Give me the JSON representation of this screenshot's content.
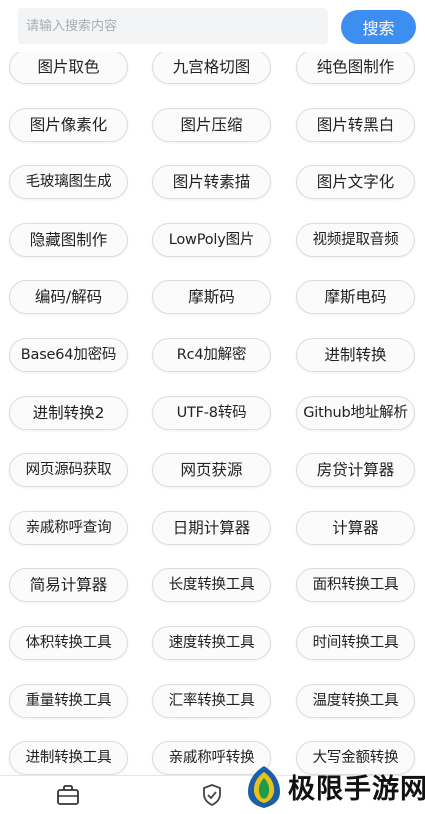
{
  "search": {
    "placeholder": "请输入搜索内容",
    "button_label": "搜索"
  },
  "tools": [
    "图片取色",
    "九宫格切图",
    "纯色图制作",
    "图片像素化",
    "图片压缩",
    "图片转黑白",
    "毛玻璃图生成",
    "图片转素描",
    "图片文字化",
    "隐藏图制作",
    "LowPoly图片",
    "视频提取音频",
    "编码/解码",
    "摩斯码",
    "摩斯电码",
    "Base64加密码",
    "Rc4加解密",
    "进制转换",
    "进制转换2",
    "UTF-8转码",
    "Github地址解析",
    "网页源码获取",
    "网页获源",
    "房贷计算器",
    "亲戚称呼查询",
    "日期计算器",
    "计算器",
    "简易计算器",
    "长度转换工具",
    "面积转换工具",
    "体积转换工具",
    "速度转换工具",
    "时间转换工具",
    "重量转换工具",
    "汇率转换工具",
    "温度转换工具",
    "进制转换工具",
    "亲戚称呼转换",
    "大写金额转换"
  ],
  "bottom_nav": {
    "icons": [
      "briefcase-icon",
      "shield-check-icon"
    ]
  },
  "watermark": {
    "text": "极限手游网"
  },
  "colors": {
    "accent": "#3d8ef1",
    "chip_bg": "#fafbfa",
    "chip_border": "#dcdcdc"
  }
}
